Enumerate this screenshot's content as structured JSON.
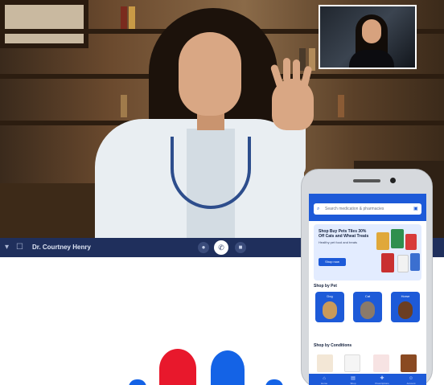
{
  "call": {
    "caller_name": "Dr. Courtney Henry",
    "end_call_icon": "end-call-icon",
    "controls": [
      "mic-icon",
      "camera-icon",
      "end-call-icon",
      "more-icon"
    ]
  },
  "phone": {
    "status_text": "",
    "search_placeholder": "Search medication & pharmacies",
    "promo": {
      "title": "Shop Buy Pets Tiles 30% Off Cats and Wheat Treats",
      "subtitle": "Healthy pet food and treats",
      "button": "Shop now"
    },
    "shop_by_pet": {
      "heading": "Shop by Pet",
      "pets": [
        "Dog",
        "Cat",
        "Horse"
      ]
    },
    "shop_by_condition": {
      "heading": "Shop by Conditions"
    },
    "tabs": [
      "Home",
      "Shop",
      "Prescriptions",
      "Account"
    ]
  },
  "colors": {
    "brand_blue": "#1d5ad8",
    "call_bar": "#1f2f5c",
    "logo_red": "#e8182c",
    "logo_blue": "#1463e6"
  }
}
